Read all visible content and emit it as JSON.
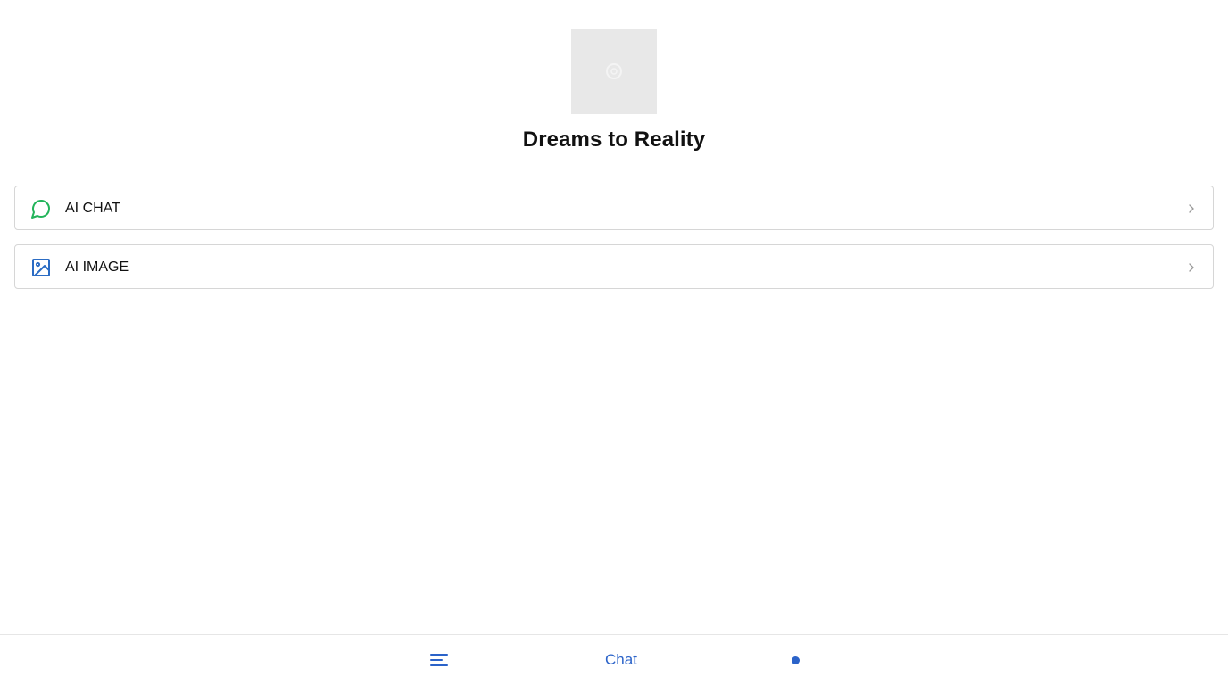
{
  "app": {
    "title": "Dreams to Reality",
    "logo_icon": "loading-placeholder-icon"
  },
  "menu": {
    "items": [
      {
        "label": "AI CHAT",
        "icon": "chat-bubble-icon",
        "icon_color": "#22b45a"
      },
      {
        "label": "AI IMAGE",
        "icon": "image-icon",
        "icon_color": "#2b6cc4"
      }
    ]
  },
  "bottom_nav": {
    "menu_icon": "hamburger-menu-icon",
    "center_label": "Chat",
    "indicator_icon": "status-dot-icon",
    "accent_color": "#2b63c9"
  }
}
